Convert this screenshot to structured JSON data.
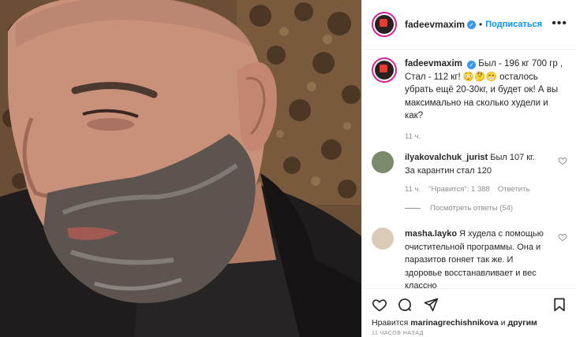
{
  "header": {
    "username": "fadeevmaxim",
    "separator": "•",
    "follow_label": "Подписаться",
    "more_icon": "more-options-icon"
  },
  "caption": {
    "username": "fadeevmaxim",
    "text": "Был - 196 кг 700 гр , Стал - 112 кг! 😳🤔😁 осталось убрать ещё 20-30кг, и будет ок! А вы максимально на сколько худели и как?",
    "time": "11 ч."
  },
  "comments": [
    {
      "username": "ilyakovalchuk_jurist",
      "text": "Был 107 кг. За карантин стал 120",
      "time": "11 ч.",
      "likes": "\"Нравится\": 1 388",
      "reply_label": "Ответить"
    },
    {
      "username": "masha.layko",
      "text": "Я худела с помощью очистительной программы. Она и паразитов гоняет так же. И здоровье восстанавливает и вес классно"
    }
  ],
  "view_replies": "Посмотреть ответы (54)",
  "actions": {
    "like_icon": "heart-icon",
    "comment_icon": "comment-icon",
    "share_icon": "share-icon",
    "save_icon": "bookmark-icon"
  },
  "likes": {
    "prefix": "Нравится",
    "user": "marinagrechishnikova",
    "middle": "и",
    "others": "другим"
  },
  "posted_time": "11 ЧАСОВ НАЗАД"
}
